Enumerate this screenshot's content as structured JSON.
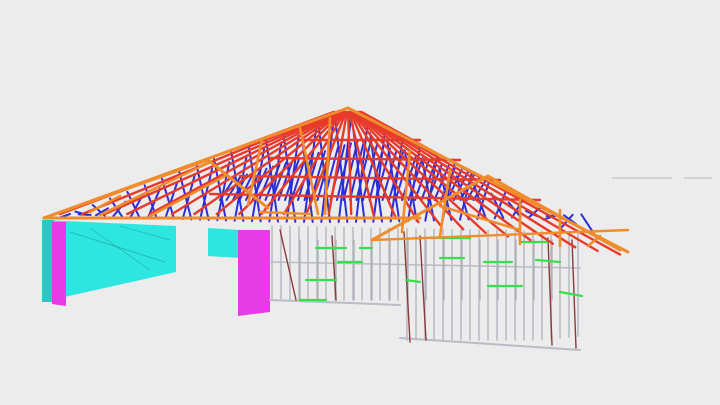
{
  "viewer": {
    "background": "#ececec",
    "model_colors": {
      "rafter": "#f08c2c",
      "top_chord": "#e83a2a",
      "web": "#2b2fd8",
      "noggin": "#37e04a",
      "wall_frame": "#b9bcc4",
      "stud_brace": "#8a3a3a",
      "panel_cyan": "#2ee6e0",
      "panel_magenta": "#e63be6"
    }
  }
}
